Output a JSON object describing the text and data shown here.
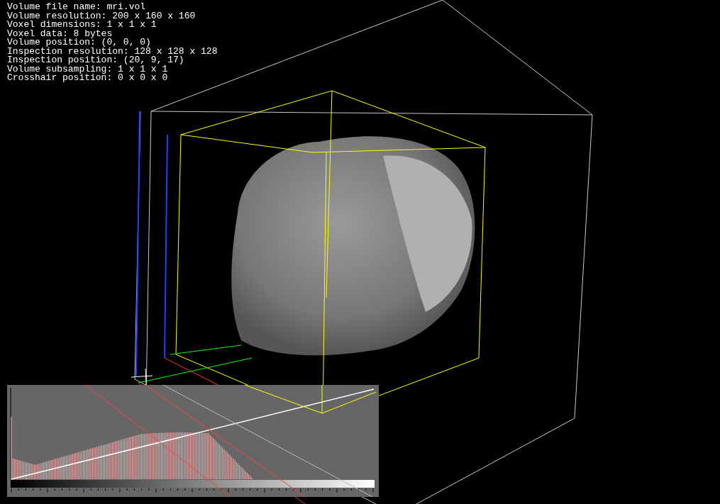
{
  "info_lines": [
    "Volume file name: mri.vol",
    "Volume resolution: 200 x 160 x 160",
    "Voxel dimensions: 1 x 1 x 1",
    "Voxel data: 8 bytes",
    "Volume position: (0, 0, 0)",
    "Inspection resolution: 128 x 128 x 128",
    "Inspection position: (20, 9, 17)",
    "Volume subsampling: 1 x 1 x 1",
    "Crosshair position: 0 x 0 x 0"
  ]
}
